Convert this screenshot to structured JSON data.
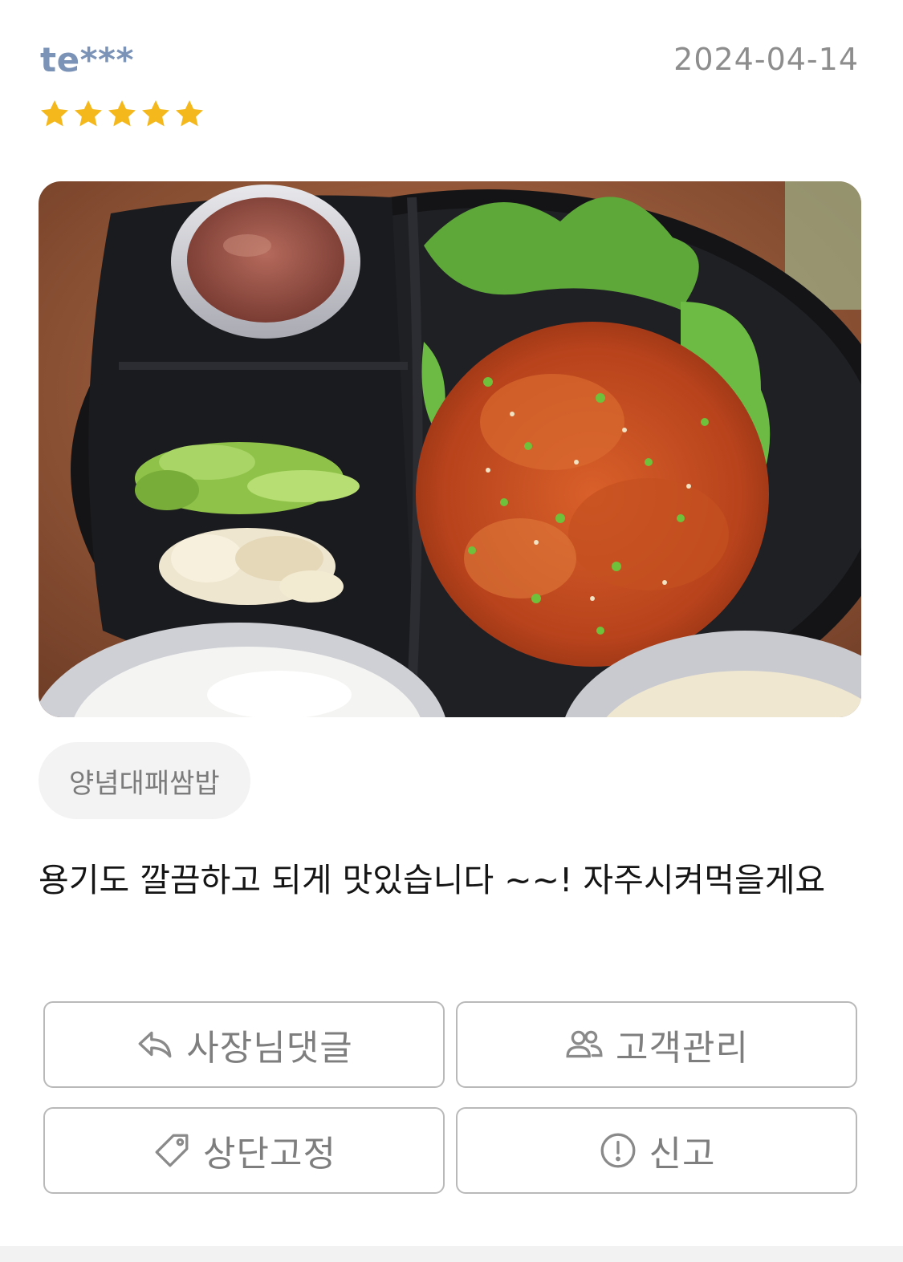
{
  "review": {
    "username": "te***",
    "date": "2024-04-14",
    "rating": 5,
    "rating_max": 5,
    "star_color": "#f5b81c",
    "photo_icon": "food-photo",
    "menu_tag": "양념대패쌈밥",
    "text": "용기도 깔끔하고 되게 맛있습니다 ~~! 자주시켜먹을게요"
  },
  "actions": {
    "reply_label": "사장님댓글",
    "reply_icon": "reply-arrow-icon",
    "customer_label": "고객관리",
    "customer_icon": "users-icon",
    "pin_label": "상단고정",
    "pin_icon": "tag-icon",
    "report_label": "신고",
    "report_icon": "alert-circle-icon"
  }
}
